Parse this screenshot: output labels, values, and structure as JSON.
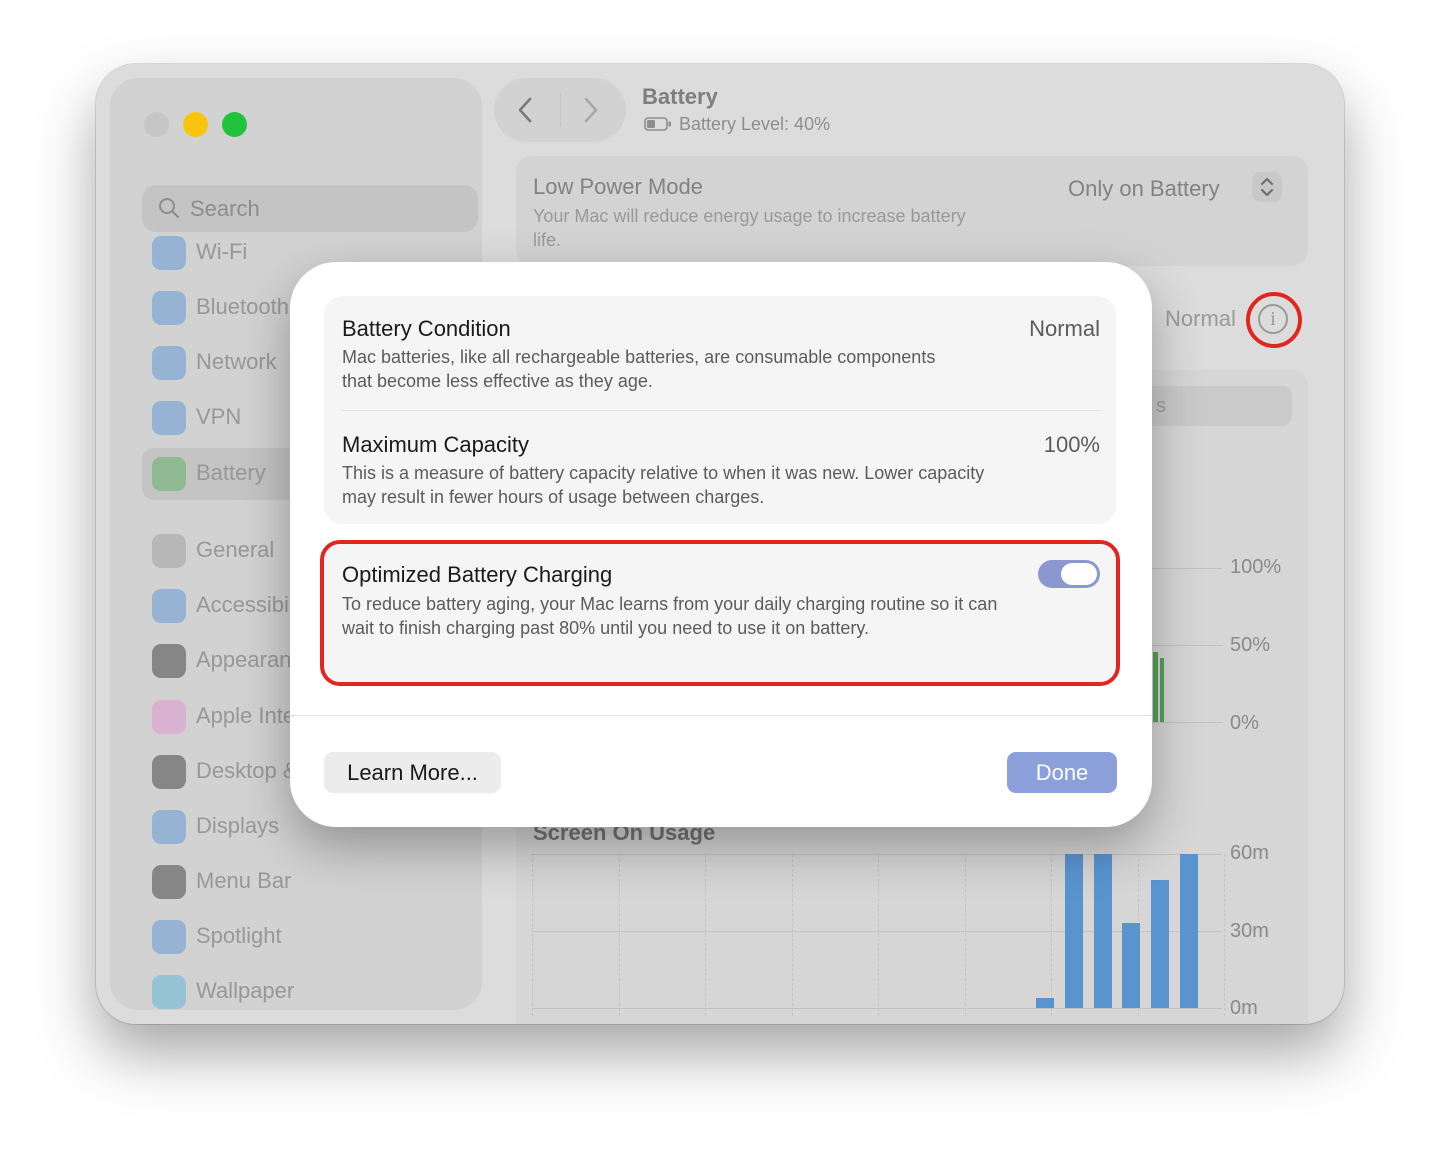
{
  "window": {
    "sidebar": {
      "search_placeholder": "Search",
      "items": [
        {
          "label": "Wi-Fi",
          "icon": "wifi-icon",
          "color": "#4f8fd6"
        },
        {
          "label": "Bluetooth",
          "icon": "bluetooth-icon",
          "color": "#4f8fd6"
        },
        {
          "label": "Network",
          "icon": "globe-icon",
          "color": "#4f8fd6"
        },
        {
          "label": "VPN",
          "icon": "globe-icon",
          "color": "#4f8fd6"
        },
        {
          "label": "Battery",
          "icon": "battery-icon",
          "color": "#4fae55"
        },
        {
          "label": "General",
          "icon": "gear-icon",
          "color": "#9a9a9a"
        },
        {
          "label": "Accessibili",
          "icon": "accessibility-icon",
          "color": "#4f8fd6"
        },
        {
          "label": "Appearanc",
          "icon": "appearance-icon",
          "color": "#2a2a2a"
        },
        {
          "label": "Apple Inte",
          "icon": "apple-intelligence-icon",
          "color": "#e28bd0"
        },
        {
          "label": "Desktop &",
          "icon": "desktop-icon",
          "color": "#2a2a2a"
        },
        {
          "label": "Displays",
          "icon": "sun-icon",
          "color": "#4f8fd6"
        },
        {
          "label": "Menu Bar",
          "icon": "menubar-icon",
          "color": "#2a2a2a"
        },
        {
          "label": "Spotlight",
          "icon": "magnifier-icon",
          "color": "#4f8fd6"
        },
        {
          "label": "Wallpaper",
          "icon": "flower-icon",
          "color": "#4fb3d6"
        }
      ]
    },
    "header": {
      "title": "Battery",
      "subtitle": "Battery Level: 40%"
    },
    "low_power": {
      "title": "Low Power Mode",
      "description": "Your Mac will reduce energy usage to increase battery life.",
      "value": "Only on Battery"
    },
    "health": {
      "value": "Normal"
    },
    "segment_partial": "s",
    "battery_chart": {
      "ticks": [
        "100%",
        "50%",
        "0%"
      ]
    },
    "screen_on": {
      "title": "Screen On Usage",
      "ticks": [
        "60m",
        "30m",
        "0m"
      ]
    }
  },
  "chart_data": [
    {
      "type": "bar",
      "title": "Screen On Usage",
      "yticks": [
        "0m",
        "30m",
        "60m"
      ],
      "ylim": [
        0,
        60
      ],
      "values": [
        0,
        0,
        0,
        0,
        0,
        0,
        0,
        0,
        0,
        0,
        0,
        0,
        0,
        0,
        0,
        0,
        0,
        4,
        60,
        60,
        33,
        50,
        60
      ],
      "unit": "minutes"
    }
  ],
  "modal": {
    "battery_condition": {
      "title": "Battery Condition",
      "description": "Mac batteries, like all rechargeable batteries, are consumable components that become less effective as they age.",
      "value": "Normal"
    },
    "maximum_capacity": {
      "title": "Maximum Capacity",
      "description": "This is a measure of battery capacity relative to when it was new. Lower capacity may result in fewer hours of usage between charges.",
      "value": "100%"
    },
    "optimized_charging": {
      "title": "Optimized Battery Charging",
      "description": "To reduce battery aging, your Mac learns from your daily charging routine so it can wait to finish charging past 80% until you need to use it on battery.",
      "enabled": true
    },
    "learn_more_label": "Learn More...",
    "done_label": "Done"
  },
  "colors": {
    "highlight": "#e0261f",
    "toggle_on": "#8b98cf",
    "done_button": "#8b9fdb",
    "usage_bar": "#5a94cf",
    "charge_bar": "#56a05a"
  }
}
